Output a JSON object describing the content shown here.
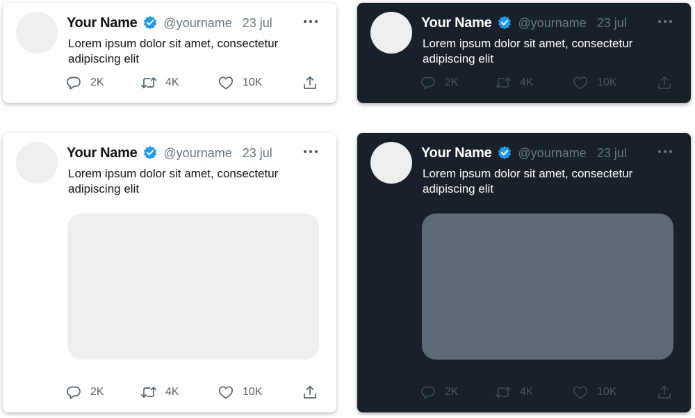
{
  "tweets": [
    {
      "name": "Your Name",
      "handle": "@yourname",
      "date": "23 jul",
      "text": "Lorem ipsum dolor sit amet, consectetur adipiscing elit",
      "replies": "2K",
      "retweets": "4K",
      "likes": "10K"
    },
    {
      "name": "Your Name",
      "handle": "@yourname",
      "date": "23 jul",
      "text": "Lorem ipsum dolor sit amet, consectetur adipiscing elit",
      "replies": "2K",
      "retweets": "4K",
      "likes": "10K"
    },
    {
      "name": "Your Name",
      "handle": "@yourname",
      "date": "23 jul",
      "text": "Lorem ipsum dolor sit amet, consectetur adipiscing elit",
      "replies": "2K",
      "retweets": "4K",
      "likes": "10K"
    },
    {
      "name": "Your Name",
      "handle": "@yourname",
      "date": "23 jul",
      "text": "Lorem ipsum dolor sit amet, consectetur adipiscing elit",
      "replies": "2K",
      "retweets": "4K",
      "likes": "10K"
    }
  ],
  "icons": {
    "verified": "verified-badge-icon",
    "more": "more-horizontal-icon",
    "reply": "reply-icon",
    "retweet": "retweet-icon",
    "like": "heart-icon",
    "share": "share-icon"
  },
  "colors": {
    "light_bg": "#ffffff",
    "dark_bg": "#18202a",
    "verified_blue": "#1d9bf0",
    "muted_text": "#657786",
    "light_media": "#efefef",
    "dark_media": "#5e6a77"
  }
}
